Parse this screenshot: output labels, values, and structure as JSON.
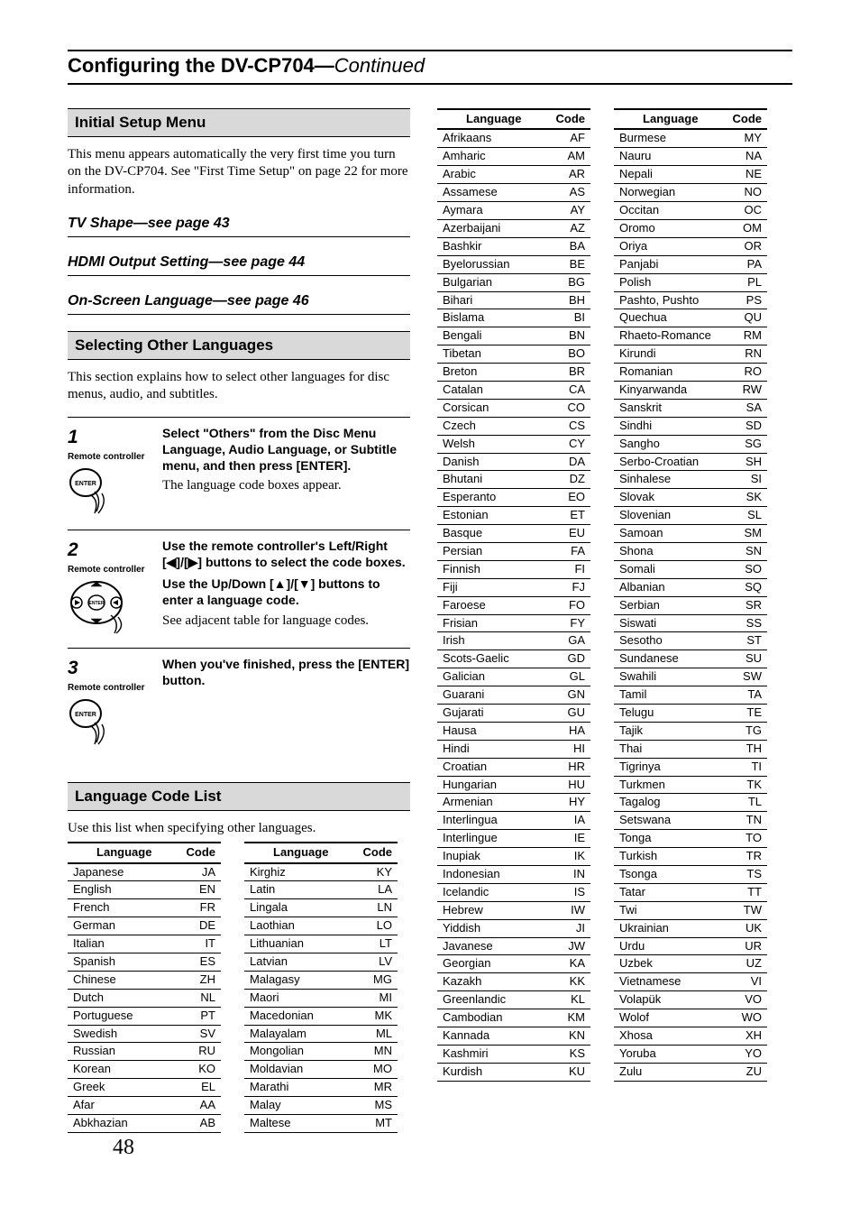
{
  "page_title_main": "Configuring the DV-CP704",
  "page_title_sep": "—",
  "page_title_cont": "Continued",
  "page_number": "48",
  "left": {
    "section1_title": "Initial Setup Menu",
    "intro_para": "This menu appears automatically the very first time you turn on the DV-CP704. See \"First Time Setup\" on page 22 for more information.",
    "sub1": "TV Shape—see page 43",
    "sub2": "HDMI Output Setting—see page 44",
    "sub3": "On-Screen Language—see page 46",
    "section2_title": "Selecting Other Languages",
    "section2_para": "This section explains how to select other languages for disc menus, audio, and subtitles.",
    "rc_label": "Remote controller",
    "step1_num": "1",
    "step1_bold": "Select \"Others\" from the Disc Menu Language, Audio Language, or Subtitle menu, and then press [ENTER].",
    "step1_serif": "The language code boxes appear.",
    "step2_num": "2",
    "step2_bold1": "Use the remote controller's Left/Right [◀]/[▶] buttons to select the code boxes.",
    "step2_bold2": "Use the Up/Down [▲]/[▼] buttons to enter a language code.",
    "step2_serif": "See adjacent table for language codes.",
    "step3_num": "3",
    "step3_bold": "When you've finished, press the [ENTER] button.",
    "section3_title": "Language Code List",
    "section3_para": "Use this list when specifying other languages.",
    "th_lang": "Language",
    "th_code": "Code"
  },
  "tables": [
    [
      [
        "Japanese",
        "JA"
      ],
      [
        "English",
        "EN"
      ],
      [
        "French",
        "FR"
      ],
      [
        "German",
        "DE"
      ],
      [
        "Italian",
        "IT"
      ],
      [
        "Spanish",
        "ES"
      ],
      [
        "Chinese",
        "ZH"
      ],
      [
        "Dutch",
        "NL"
      ],
      [
        "Portuguese",
        "PT"
      ],
      [
        "Swedish",
        "SV"
      ],
      [
        "Russian",
        "RU"
      ],
      [
        "Korean",
        "KO"
      ],
      [
        "Greek",
        "EL"
      ],
      [
        "Afar",
        "AA"
      ],
      [
        "Abkhazian",
        "AB"
      ]
    ],
    [
      [
        "Kirghiz",
        "KY"
      ],
      [
        "Latin",
        "LA"
      ],
      [
        "Lingala",
        "LN"
      ],
      [
        "Laothian",
        "LO"
      ],
      [
        "Lithuanian",
        "LT"
      ],
      [
        "Latvian",
        "LV"
      ],
      [
        "Malagasy",
        "MG"
      ],
      [
        "Maori",
        "MI"
      ],
      [
        "Macedonian",
        "MK"
      ],
      [
        "Malayalam",
        "ML"
      ],
      [
        "Mongolian",
        "MN"
      ],
      [
        "Moldavian",
        "MO"
      ],
      [
        "Marathi",
        "MR"
      ],
      [
        "Malay",
        "MS"
      ],
      [
        "Maltese",
        "MT"
      ]
    ],
    [
      [
        "Afrikaans",
        "AF"
      ],
      [
        "Amharic",
        "AM"
      ],
      [
        "Arabic",
        "AR"
      ],
      [
        "Assamese",
        "AS"
      ],
      [
        "Aymara",
        "AY"
      ],
      [
        "Azerbaijani",
        "AZ"
      ],
      [
        "Bashkir",
        "BA"
      ],
      [
        "Byelorussian",
        "BE"
      ],
      [
        "Bulgarian",
        "BG"
      ],
      [
        "Bihari",
        "BH"
      ],
      [
        "Bislama",
        "BI"
      ],
      [
        "Bengali",
        "BN"
      ],
      [
        "Tibetan",
        "BO"
      ],
      [
        "Breton",
        "BR"
      ],
      [
        "Catalan",
        "CA"
      ],
      [
        "Corsican",
        "CO"
      ],
      [
        "Czech",
        "CS"
      ],
      [
        "Welsh",
        "CY"
      ],
      [
        "Danish",
        "DA"
      ],
      [
        "Bhutani",
        "DZ"
      ],
      [
        "Esperanto",
        "EO"
      ],
      [
        "Estonian",
        "ET"
      ],
      [
        "Basque",
        "EU"
      ],
      [
        "Persian",
        "FA"
      ],
      [
        "Finnish",
        "FI"
      ],
      [
        "Fiji",
        "FJ"
      ],
      [
        "Faroese",
        "FO"
      ],
      [
        "Frisian",
        "FY"
      ],
      [
        "Irish",
        "GA"
      ],
      [
        "Scots-Gaelic",
        "GD"
      ],
      [
        "Galician",
        "GL"
      ],
      [
        "Guarani",
        "GN"
      ],
      [
        "Gujarati",
        "GU"
      ],
      [
        "Hausa",
        "HA"
      ],
      [
        "Hindi",
        "HI"
      ],
      [
        "Croatian",
        "HR"
      ],
      [
        "Hungarian",
        "HU"
      ],
      [
        "Armenian",
        "HY"
      ],
      [
        "Interlingua",
        "IA"
      ],
      [
        "Interlingue",
        "IE"
      ],
      [
        "Inupiak",
        "IK"
      ],
      [
        "Indonesian",
        "IN"
      ],
      [
        "Icelandic",
        "IS"
      ],
      [
        "Hebrew",
        "IW"
      ],
      [
        "Yiddish",
        "JI"
      ],
      [
        "Javanese",
        "JW"
      ],
      [
        "Georgian",
        "KA"
      ],
      [
        "Kazakh",
        "KK"
      ],
      [
        "Greenlandic",
        "KL"
      ],
      [
        "Cambodian",
        "KM"
      ],
      [
        "Kannada",
        "KN"
      ],
      [
        "Kashmiri",
        "KS"
      ],
      [
        "Kurdish",
        "KU"
      ]
    ],
    [
      [
        "Burmese",
        "MY"
      ],
      [
        "Nauru",
        "NA"
      ],
      [
        "Nepali",
        "NE"
      ],
      [
        "Norwegian",
        "NO"
      ],
      [
        "Occitan",
        "OC"
      ],
      [
        "Oromo",
        "OM"
      ],
      [
        "Oriya",
        "OR"
      ],
      [
        "Panjabi",
        "PA"
      ],
      [
        "Polish",
        "PL"
      ],
      [
        "Pashto, Pushto",
        "PS"
      ],
      [
        "Quechua",
        "QU"
      ],
      [
        "Rhaeto-Romance",
        "RM"
      ],
      [
        "Kirundi",
        "RN"
      ],
      [
        "Romanian",
        "RO"
      ],
      [
        "Kinyarwanda",
        "RW"
      ],
      [
        "Sanskrit",
        "SA"
      ],
      [
        "Sindhi",
        "SD"
      ],
      [
        "Sangho",
        "SG"
      ],
      [
        "Serbo-Croatian",
        "SH"
      ],
      [
        "Sinhalese",
        "SI"
      ],
      [
        "Slovak",
        "SK"
      ],
      [
        "Slovenian",
        "SL"
      ],
      [
        "Samoan",
        "SM"
      ],
      [
        "Shona",
        "SN"
      ],
      [
        "Somali",
        "SO"
      ],
      [
        "Albanian",
        "SQ"
      ],
      [
        "Serbian",
        "SR"
      ],
      [
        "Siswati",
        "SS"
      ],
      [
        "Sesotho",
        "ST"
      ],
      [
        "Sundanese",
        "SU"
      ],
      [
        "Swahili",
        "SW"
      ],
      [
        "Tamil",
        "TA"
      ],
      [
        "Telugu",
        "TE"
      ],
      [
        "Tajik",
        "TG"
      ],
      [
        "Thai",
        "TH"
      ],
      [
        "Tigrinya",
        "TI"
      ],
      [
        "Turkmen",
        "TK"
      ],
      [
        "Tagalog",
        "TL"
      ],
      [
        "Setswana",
        "TN"
      ],
      [
        "Tonga",
        "TO"
      ],
      [
        "Turkish",
        "TR"
      ],
      [
        "Tsonga",
        "TS"
      ],
      [
        "Tatar",
        "TT"
      ],
      [
        "Twi",
        "TW"
      ],
      [
        "Ukrainian",
        "UK"
      ],
      [
        "Urdu",
        "UR"
      ],
      [
        "Uzbek",
        "UZ"
      ],
      [
        "Vietnamese",
        "VI"
      ],
      [
        "Volapük",
        "VO"
      ],
      [
        "Wolof",
        "WO"
      ],
      [
        "Xhosa",
        "XH"
      ],
      [
        "Yoruba",
        "YO"
      ],
      [
        "Zulu",
        "ZU"
      ]
    ]
  ]
}
